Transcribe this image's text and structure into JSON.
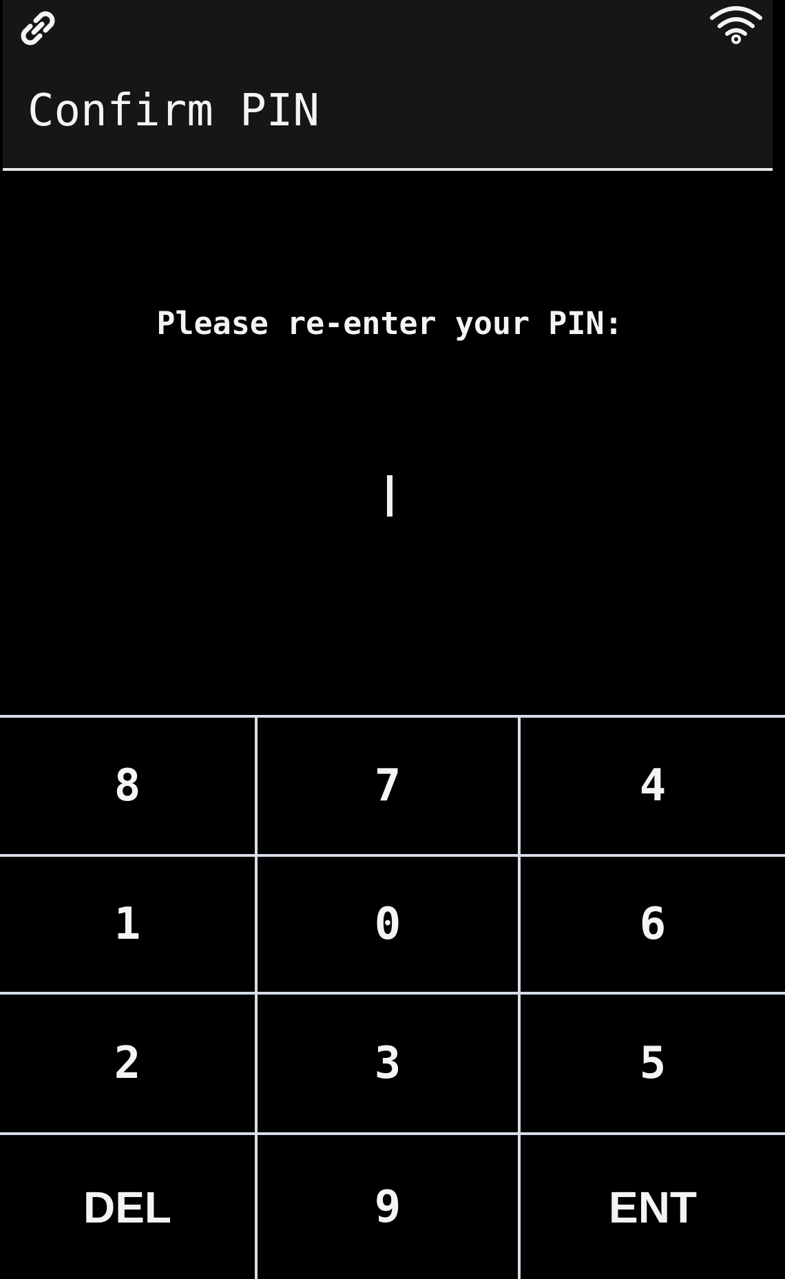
{
  "header": {
    "title": "Confirm PIN",
    "left_icon": "link-icon",
    "right_icon": "wifi-icon"
  },
  "main": {
    "prompt": "Please re-enter your PIN:",
    "pin_value": ""
  },
  "keypad": {
    "keys": [
      {
        "label": "8"
      },
      {
        "label": "7"
      },
      {
        "label": "4"
      },
      {
        "label": "1"
      },
      {
        "label": "0"
      },
      {
        "label": "6"
      },
      {
        "label": "2"
      },
      {
        "label": "3"
      },
      {
        "label": "5"
      },
      {
        "label": "DEL"
      },
      {
        "label": "9"
      },
      {
        "label": "ENT"
      }
    ]
  },
  "colors": {
    "background": "#000000",
    "header_background": "#151618",
    "text": "#f4f4f4",
    "grid_lines": "#d8dee8"
  }
}
